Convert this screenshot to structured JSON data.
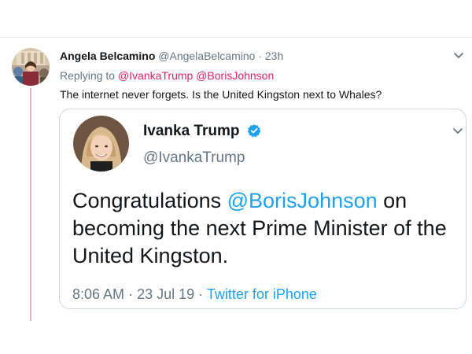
{
  "tweet": {
    "author_name": "Angela Belcamino",
    "author_handle": "@AngelaBelcamino",
    "separator": "·",
    "time": "23h",
    "replying_to_label": "Replying to",
    "replying_to": [
      "@IvankaTrump",
      "@BorisJohnson"
    ],
    "text": "The internet never forgets. Is the United Kingston next to Whales?"
  },
  "quoted_tweet": {
    "author_name": "Ivanka Trump",
    "author_handle": "@IvankaTrump",
    "text_before": "Congratulations ",
    "text_mention": "@BorisJohnson",
    "text_after": " on becoming the next Prime Minister of the United Kingston.",
    "time": "8:06 AM",
    "separator": "·",
    "date": "23 Jul 19",
    "source": "Twitter for iPhone"
  },
  "icons": {
    "chevron": "chevron-down-icon",
    "verified": "verified-badge-icon"
  },
  "colors": {
    "text": "#14171a",
    "secondary": "#657786",
    "link_blue": "#1da1f2",
    "mention_pink": "#e0245e",
    "thread_line": "#f4a6b8",
    "card_border": "#ccd6dd"
  }
}
